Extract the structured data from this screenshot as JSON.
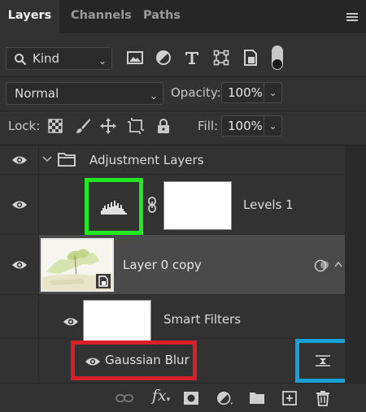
{
  "tabs": [
    {
      "label": "Layers",
      "active": true
    },
    {
      "label": "Channels",
      "active": false
    },
    {
      "label": "Paths",
      "active": false
    }
  ],
  "filter": {
    "kind_label": "Kind",
    "filter_icons": [
      "image-filter-icon",
      "adjustment-filter-icon",
      "type-filter-icon",
      "shape-filter-icon",
      "smart-object-filter-icon"
    ],
    "toggle_icon": "filter-toggle-icon"
  },
  "blend": {
    "mode": "Normal",
    "opacity_label": "Opacity:",
    "opacity_value": "100%"
  },
  "lock": {
    "label": "Lock:",
    "fill_label": "Fill:",
    "fill_value": "100%",
    "icons": [
      "lock-transparent-pixels-icon",
      "lock-image-pixels-icon",
      "lock-position-icon",
      "prevent-autonest-icon",
      "lock-all-icon"
    ]
  },
  "layers": {
    "group_name": "Adjustment Layers",
    "levels_name": "Levels 1",
    "layer0_name": "Layer 0 copy",
    "smart_filters_name": "Smart Filters",
    "gaussian_name": "Gaussian Blur"
  },
  "colors": {
    "highlight_green": "#22e822",
    "highlight_red": "#d8202a",
    "highlight_blue": "#1aa0d8",
    "selected_row": "#4a4a4a",
    "panel_bg": "#323232"
  },
  "bottom_icons": [
    "link-layers-icon",
    "fx-icon",
    "add-mask-icon",
    "new-fill-adjustment-icon",
    "new-group-icon",
    "new-layer-icon",
    "delete-layer-icon"
  ]
}
